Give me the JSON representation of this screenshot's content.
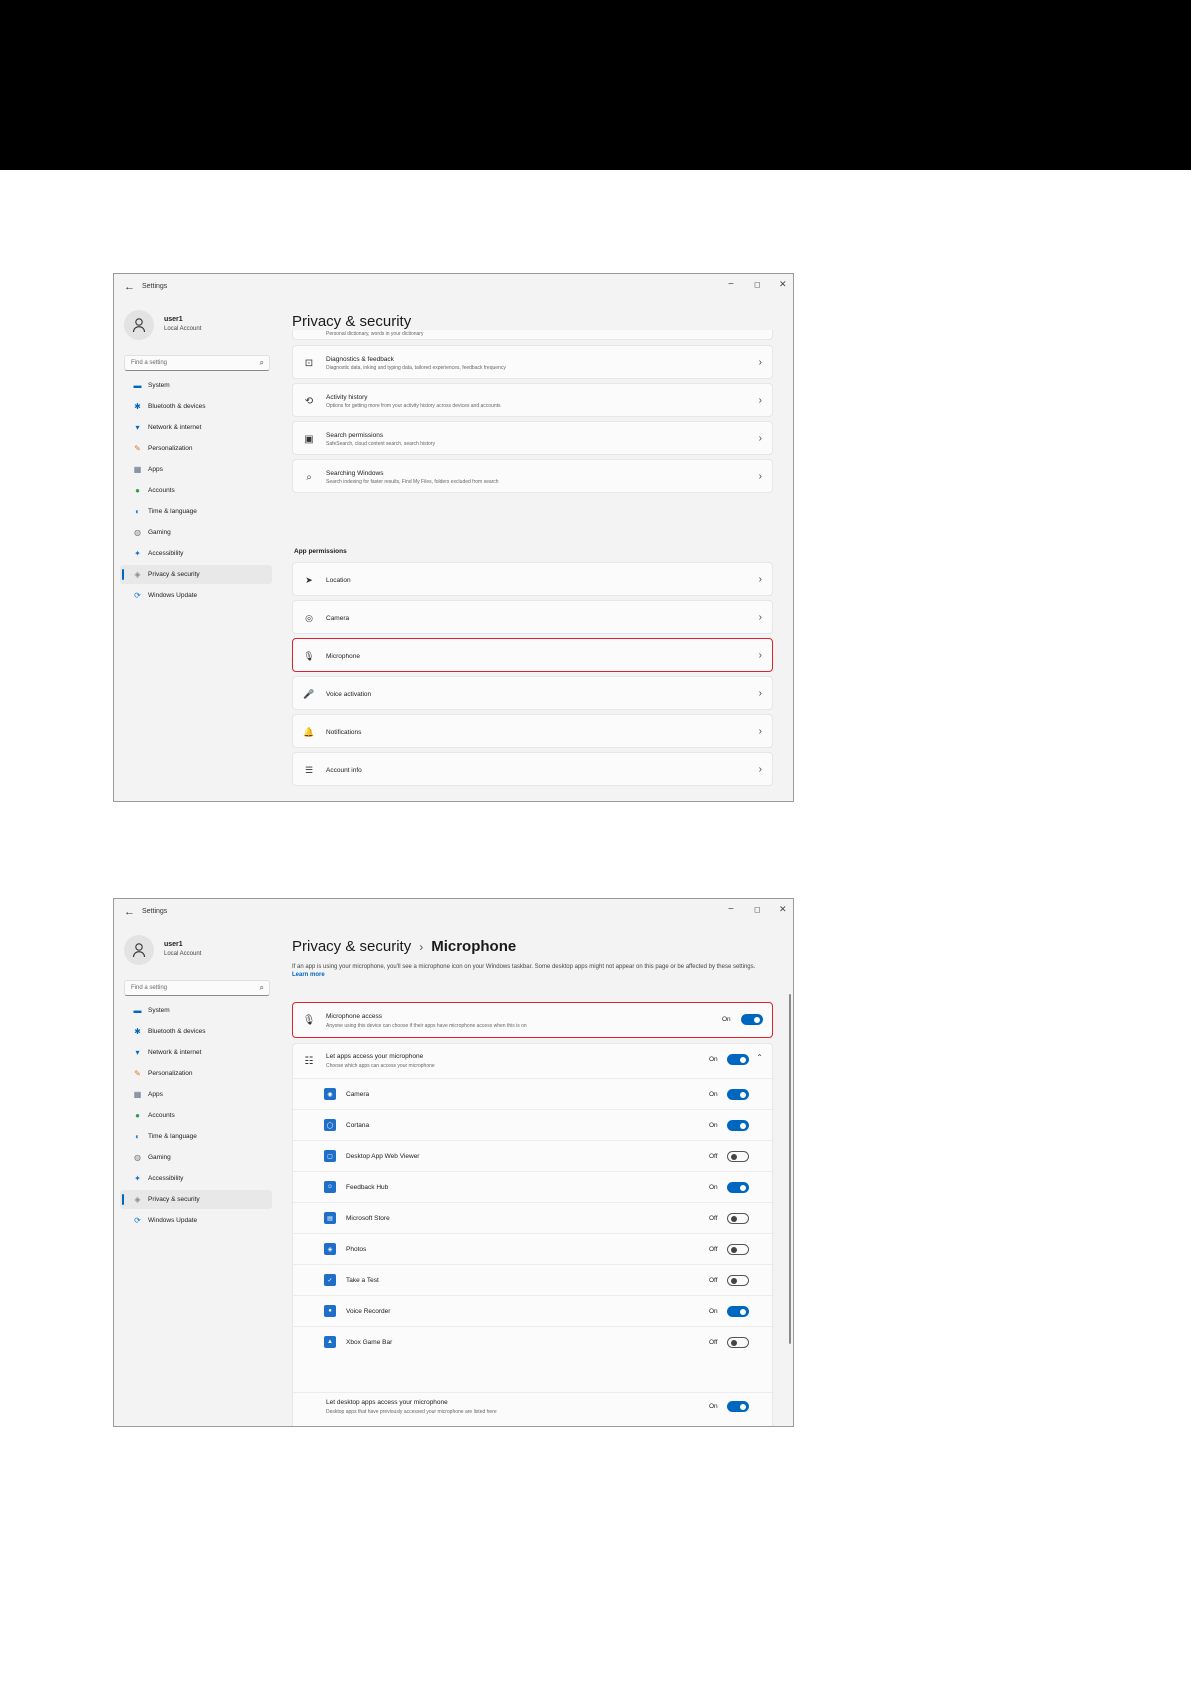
{
  "window": {
    "title": "Settings",
    "minimize": "−",
    "maximize": "◻",
    "close": "✕",
    "back": "←"
  },
  "user": {
    "name": "user1",
    "account": "Local Account"
  },
  "search": {
    "placeholder": "Find a setting"
  },
  "nav": [
    {
      "label": "System",
      "icon": "system-icon",
      "color": "#0067c0"
    },
    {
      "label": "Bluetooth & devices",
      "icon": "bluetooth-icon",
      "color": "#0067c0"
    },
    {
      "label": "Network & internet",
      "icon": "wifi-icon",
      "color": "#0067c0"
    },
    {
      "label": "Personalization",
      "icon": "brush-icon",
      "color": "#d87a1f"
    },
    {
      "label": "Apps",
      "icon": "apps-icon",
      "color": "#5a6b82"
    },
    {
      "label": "Accounts",
      "icon": "accounts-icon",
      "color": "#2ea043"
    },
    {
      "label": "Time & language",
      "icon": "globe-clock-icon",
      "color": "#0a7bd8"
    },
    {
      "label": "Gaming",
      "icon": "gamepad-icon",
      "color": "#7a7a7a"
    },
    {
      "label": "Accessibility",
      "icon": "accessibility-icon",
      "color": "#1f6fc8"
    },
    {
      "label": "Privacy & security",
      "icon": "shield-icon",
      "color": "#8a8a8a"
    },
    {
      "label": "Windows Update",
      "icon": "update-icon",
      "color": "#0a7bd8"
    }
  ],
  "screen1": {
    "page_title": "Privacy & security",
    "top_partial": "Personal dictionary, words in your dictionary",
    "items": [
      {
        "title": "Diagnostics & feedback",
        "subtitle": "Diagnostic data, inking and typing data, tailored experiences, feedback frequency",
        "icon": "diagnostics-icon",
        "glyph": "⊡"
      },
      {
        "title": "Activity history",
        "subtitle": "Options for getting more from your activity history across devices and accounts",
        "icon": "history-icon",
        "glyph": "⟲"
      },
      {
        "title": "Search permissions",
        "subtitle": "SafeSearch, cloud content search, search history",
        "icon": "search-permissions-icon",
        "glyph": "▣"
      },
      {
        "title": "Searching Windows",
        "subtitle": "Search indexing for faster results, Find My Files, folders excluded from search",
        "icon": "searching-windows-icon",
        "glyph": "⌕"
      }
    ],
    "section_label": "App permissions",
    "permissions": [
      {
        "title": "Location",
        "icon": "location-icon",
        "glyph": "➤"
      },
      {
        "title": "Camera",
        "icon": "camera-icon",
        "glyph": "◎"
      },
      {
        "title": "Microphone",
        "icon": "microphone-icon",
        "glyph": "🎙"
      },
      {
        "title": "Voice activation",
        "icon": "voice-activation-icon",
        "glyph": "🎤"
      },
      {
        "title": "Notifications",
        "icon": "bell-icon",
        "glyph": "🔔"
      },
      {
        "title": "Account info",
        "icon": "account-info-icon",
        "glyph": "☰"
      }
    ]
  },
  "screen2": {
    "breadcrumb_parent": "Privacy & security",
    "breadcrumb_sep": "›",
    "breadcrumb_current": "Microphone",
    "description": "If an app is using your microphone, you'll see a microphone icon on your Windows taskbar. Some desktop apps might not appear on this page or be affected by these settings.",
    "learn_more": "Learn more",
    "mic_access": {
      "title": "Microphone access",
      "subtitle": "Anyone using this device can choose if their apps have microphone access when this is on",
      "state": "On"
    },
    "let_apps": {
      "title": "Let apps access your microphone",
      "subtitle": "Choose which apps can access your microphone",
      "state": "On"
    },
    "apps": [
      {
        "name": "Camera",
        "state": "On",
        "on": true
      },
      {
        "name": "Cortana",
        "state": "On",
        "on": true
      },
      {
        "name": "Desktop App Web Viewer",
        "state": "Off",
        "on": false
      },
      {
        "name": "Feedback Hub",
        "state": "On",
        "on": true
      },
      {
        "name": "Microsoft Store",
        "state": "Off",
        "on": false
      },
      {
        "name": "Photos",
        "state": "Off",
        "on": false
      },
      {
        "name": "Take a Test",
        "state": "Off",
        "on": false
      },
      {
        "name": "Voice Recorder",
        "state": "On",
        "on": true
      },
      {
        "name": "Xbox Game Bar",
        "state": "Off",
        "on": false
      }
    ],
    "desktop_apps": {
      "title": "Let desktop apps access your microphone",
      "subtitle": "Desktop apps that have previously accessed your microphone are listed here",
      "state": "On"
    }
  },
  "colors": {
    "accent": "#0067c0",
    "highlight": "#d9232e"
  }
}
